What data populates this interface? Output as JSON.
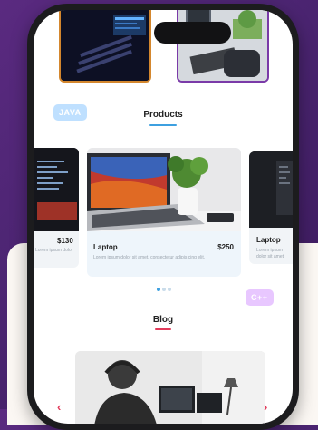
{
  "products_section": {
    "title": "Products",
    "underline_color": "#3da0e0",
    "cards": [
      {
        "title": "",
        "price": "$130",
        "desc": "Lorem ipsum dolor sit amet, consectetur adipis"
      },
      {
        "title": "Laptop",
        "price": "$250",
        "desc": "Lorem ipsum dolor sit amet, consectetur adipis cing elit."
      },
      {
        "title": "Laptop",
        "price": "",
        "desc": "Lorem ipsum dolor sit amet"
      }
    ],
    "carousel_dots": 3,
    "active_dot": 0
  },
  "badges": {
    "java": "JAVA",
    "cpp": "C++"
  },
  "blog_section": {
    "title": "Blog",
    "underline_color": "#e23a5a",
    "prev_arrow": "‹",
    "next_arrow": "›"
  },
  "colors": {
    "background_purple": "#4a2470",
    "phone_frame": "#1c1c1e",
    "accent_orange": "#d4872e",
    "accent_purple": "#7a3aa8"
  }
}
